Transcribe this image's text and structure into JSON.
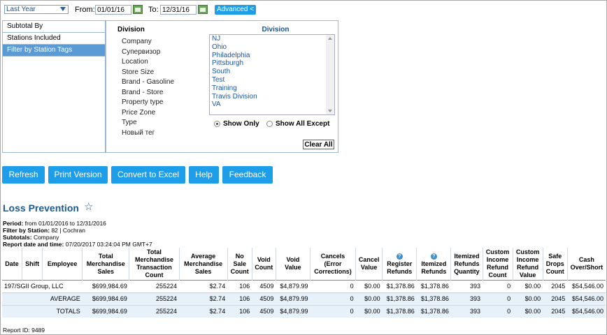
{
  "toolbar": {
    "period_value": "Last Year",
    "from_label": "From:",
    "from_value": "01/01/16",
    "to_label": "To:",
    "to_value": "12/31/16",
    "advanced_label": "Advanced <"
  },
  "filters": {
    "left_items": [
      {
        "label": "Subtotal By"
      },
      {
        "label": "Stations Included"
      },
      {
        "label": "Filter by Station Tags"
      }
    ],
    "tag_title": "Division",
    "tag_items": [
      "Company",
      "Супервизор",
      "Location",
      "Store Size",
      "Brand - Gasoline",
      "Brand - Store",
      "Property type",
      "Price Zone",
      "Type",
      "Новый тег"
    ],
    "division_title": "Division",
    "division_items": [
      "NJ",
      "Ohio",
      "Philadelphia",
      "Pittsburgh",
      "South",
      "Test",
      "Training",
      "Travis Division",
      "VA"
    ],
    "show_only_label": "Show Only",
    "show_all_except_label": "Show All Except",
    "clear_all_label": "Clear All"
  },
  "actions": {
    "refresh": "Refresh",
    "print_version": "Print Version",
    "convert_excel": "Convert to Excel",
    "help": "Help",
    "feedback": "Feedback"
  },
  "report": {
    "title": "Loss Prevention",
    "period_label": "Period:",
    "period_value": "from 01/01/2016 to 12/31/2016",
    "filter_label": "Filter by Station:",
    "filter_value": "82 | Cochran",
    "subtotals_label": "Subtotals:",
    "subtotals_value": "Company",
    "report_date_label": "Report date and time:",
    "report_date_value": "07/20/2017 03:24:04 PM GMT+7",
    "columns": [
      "Date",
      "Shift",
      "Employee",
      "Total Merchandise Sales",
      "Total Merchandise Transaction Count",
      "Average Merchandise Sales",
      "No Sale Count",
      "Void Count",
      "Void Value",
      "Cancels (Error Corrections)",
      "Cancel Value",
      "Register Refunds",
      "Itemized Refunds",
      "Itemized Refunds Quantity",
      "Custom Income Refund Count",
      "Custom Income Refund Value",
      "Safe Drops Count",
      "Cash Over/Short"
    ],
    "rows": [
      {
        "label": "197/SGII Group, LLC",
        "cells": [
          "$699,984.69",
          "255224",
          "$2.74",
          "106",
          "4509",
          "$4,879.99",
          "0",
          "$0.00",
          "$1,378.86",
          "$1,378.86",
          "393",
          "0",
          "$0.00",
          "2045",
          "$54,546.00"
        ]
      },
      {
        "label": "AVERAGE",
        "cells": [
          "$699,984.69",
          "255224",
          "$2.74",
          "106",
          "4509",
          "$4,879.99",
          "0",
          "$0.00",
          "$1,378.86",
          "$1,378.86",
          "393",
          "0",
          "$0.00",
          "2045",
          "$54,546.00"
        ]
      },
      {
        "label": "TOTALS",
        "cells": [
          "$699,984.69",
          "255224",
          "$2.74",
          "106",
          "4509",
          "$4,879.99",
          "0",
          "$0.00",
          "$1,378.86",
          "$1,378.86",
          "393",
          "0",
          "$0.00",
          "2045",
          "$54,546.00"
        ]
      }
    ],
    "report_id": "Report ID: 9489"
  }
}
